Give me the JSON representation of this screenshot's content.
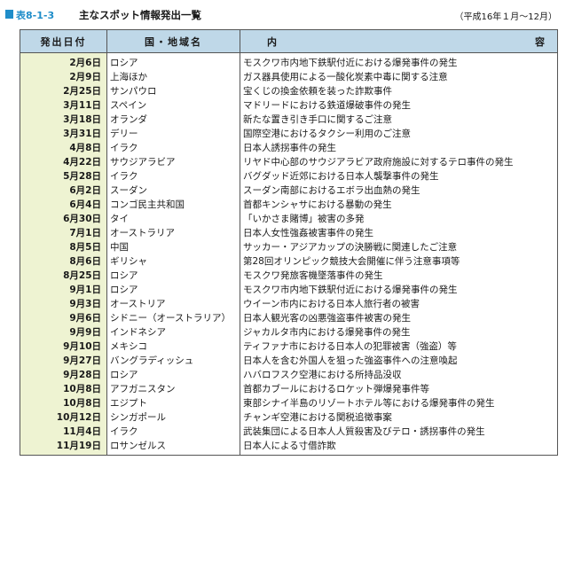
{
  "title": {
    "number": "表8-1-3",
    "text": "主なスポット情報発出一覧",
    "period": "（平成16年１月～12月）"
  },
  "header": {
    "date": "発出日付",
    "country": "国・地域名",
    "content_a": "内",
    "content_b": "容"
  },
  "rows": [
    {
      "date": "2月6日",
      "country": "ロシア",
      "content": "モスクワ市内地下鉄駅付近における爆発事件の発生"
    },
    {
      "date": "2月9日",
      "country": "上海ほか",
      "content": "ガス器具使用による一酸化炭素中毒に関する注意"
    },
    {
      "date": "2月25日",
      "country": "サンパウロ",
      "content": "宝くじの換金依頼を装った詐欺事件"
    },
    {
      "date": "3月11日",
      "country": "スペイン",
      "content": "マドリードにおける鉄道爆破事件の発生"
    },
    {
      "date": "3月18日",
      "country": "オランダ",
      "content": "新たな置き引き手口に関するご注意"
    },
    {
      "date": "3月31日",
      "country": "デリー",
      "content": "国際空港におけるタクシー利用のご注意"
    },
    {
      "date": "4月8日",
      "country": "イラク",
      "content": "日本人誘拐事件の発生"
    },
    {
      "date": "4月22日",
      "country": "サウジアラビア",
      "content": "リヤド中心部のサウジアラビア政府施設に対するテロ事件の発生"
    },
    {
      "date": "5月28日",
      "country": "イラク",
      "content": "バグダッド近郊における日本人襲撃事件の発生"
    },
    {
      "date": "6月2日",
      "country": "スーダン",
      "content": "スーダン南部におけるエボラ出血熱の発生"
    },
    {
      "date": "6月4日",
      "country": "コンゴ民主共和国",
      "content": "首都キンシャサにおける暴動の発生"
    },
    {
      "date": "6月30日",
      "country": "タイ",
      "content": "「いかさま賭博」被害の多発"
    },
    {
      "date": "7月1日",
      "country": "オーストラリア",
      "content": "日本人女性強姦被害事件の発生"
    },
    {
      "date": "8月5日",
      "country": "中国",
      "content": "サッカー・アジアカップの決勝戦に関連したご注意"
    },
    {
      "date": "8月6日",
      "country": "ギリシャ",
      "content": "第28回オリンピック競技大会開催に伴う注意事項等"
    },
    {
      "date": "8月25日",
      "country": "ロシア",
      "content": "モスクワ発旅客機墜落事件の発生"
    },
    {
      "date": "9月1日",
      "country": "ロシア",
      "content": "モスクワ市内地下鉄駅付近における爆発事件の発生"
    },
    {
      "date": "9月3日",
      "country": "オーストリア",
      "content": "ウイーン市内における日本人旅行者の被害"
    },
    {
      "date": "9月6日",
      "country": "シドニー（オーストラリア）",
      "content": "日本人観光客の凶悪強盗事件被害の発生"
    },
    {
      "date": "9月9日",
      "country": "インドネシア",
      "content": "ジャカルタ市内における爆発事件の発生"
    },
    {
      "date": "9月10日",
      "country": "メキシコ",
      "content": "ティファナ市における日本人の犯罪被害（強盗）等"
    },
    {
      "date": "9月27日",
      "country": "バングラディッシュ",
      "content": "日本人を含む外国人を狙った強盗事件への注意喚起"
    },
    {
      "date": "9月28日",
      "country": "ロシア",
      "content": "ハバロフスク空港における所持品没収"
    },
    {
      "date": "10月8日",
      "country": "アフガニスタン",
      "content": "首都カブールにおけるロケット弾爆発事件等"
    },
    {
      "date": "10月8日",
      "country": "エジプト",
      "content": "東部シナイ半島のリゾートホテル等における爆発事件の発生"
    },
    {
      "date": "10月12日",
      "country": "シンガポール",
      "content": "チャンギ空港における関税追徴事案"
    },
    {
      "date": "11月4日",
      "country": "イラク",
      "content": "武装集団による日本人人質殺害及びテロ・誘拐事件の発生"
    },
    {
      "date": "11月19日",
      "country": "ロサンゼルス",
      "content": "日本人による寸借詐欺"
    }
  ],
  "colors": {
    "accent": "#1f8dc9",
    "header_bg": "#bfd8e8",
    "date_bg": "#eef3d2"
  }
}
